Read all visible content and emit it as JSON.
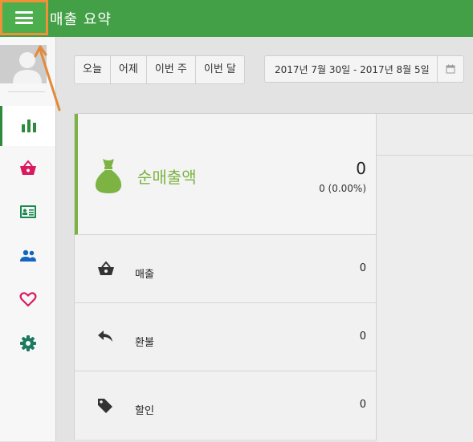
{
  "header": {
    "title": "매출 요약"
  },
  "toolbar": {
    "quick_ranges": [
      "오늘",
      "어제",
      "이번 주",
      "이번 달"
    ],
    "date_range": "2017년 7월 30일 - 2017년 8월 5일"
  },
  "summary": {
    "net_sales_label": "순매출액",
    "net_sales_value": "0",
    "net_sales_percent": "0 (0.00%)"
  },
  "rows": [
    {
      "label": "매출",
      "value": "0",
      "icon": "basket-icon"
    },
    {
      "label": "환불",
      "value": "0",
      "icon": "reply-icon"
    },
    {
      "label": "할인",
      "value": "0",
      "icon": "tag-icon"
    }
  ],
  "sidebar": {
    "items": [
      {
        "icon": "bar-chart-icon",
        "color": "#2e8b3b",
        "active": true
      },
      {
        "icon": "basket-icon",
        "color": "#d81b60"
      },
      {
        "icon": "id-card-icon",
        "color": "#1b8a4f"
      },
      {
        "icon": "people-icon",
        "color": "#1565c0"
      },
      {
        "icon": "heart-icon",
        "color": "#d81b60"
      },
      {
        "icon": "gear-icon",
        "color": "#1b7a60"
      }
    ]
  },
  "colors": {
    "topbar": "#43a047",
    "accent": "#7cb342",
    "annotation": "#f0913a"
  }
}
